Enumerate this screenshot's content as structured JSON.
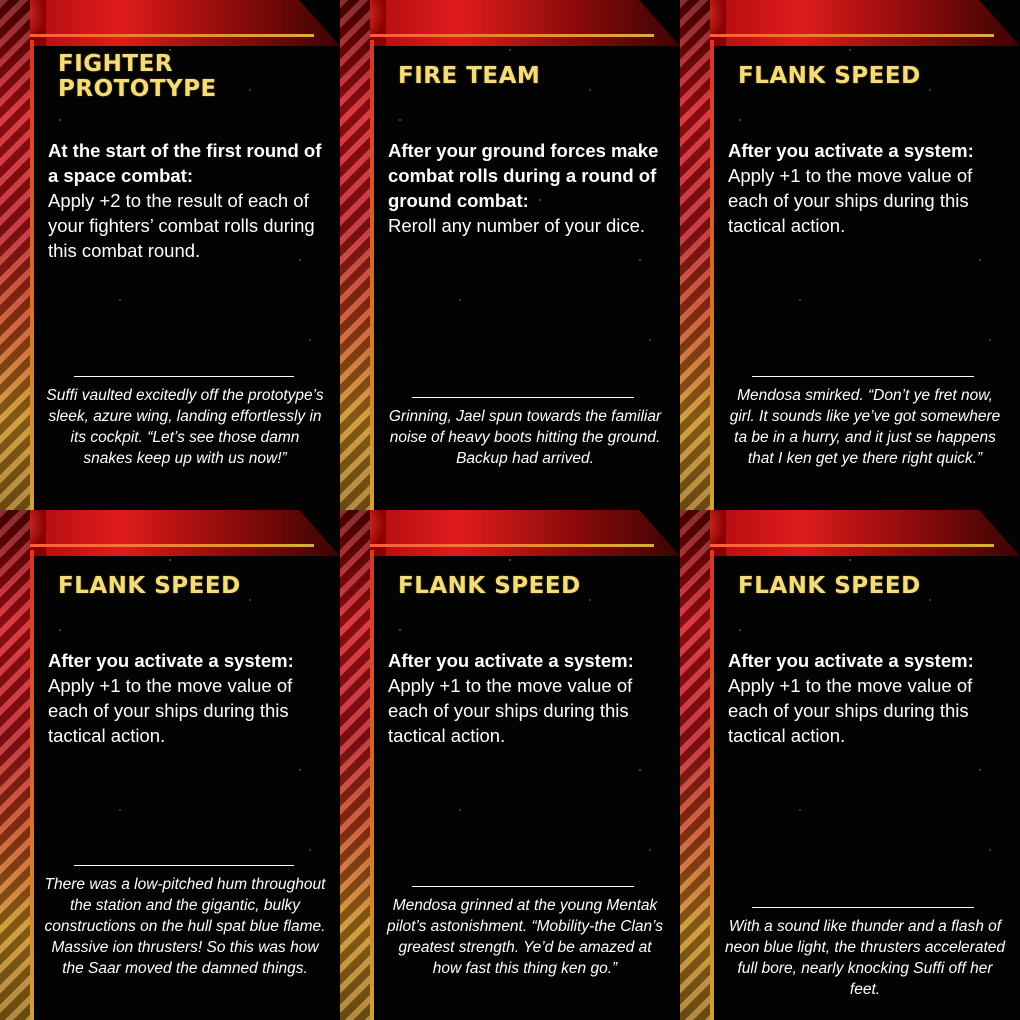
{
  "cards": [
    {
      "title_line1": "FIGHTER",
      "title_line2": "PROTOTYPE",
      "trigger": "At the start of the first round of a space combat:",
      "effect": "Apply +2 to the result of each of your fighters’ combat rolls during this combat round.",
      "flavor": "Suffi vaulted excitedly off the prototype’s sleek, azure wing, landing effortlessly in its cockpit. “Let’s see those damn snakes keep up with us now!”"
    },
    {
      "title_line1": "FIRE TEAM",
      "title_line2": "",
      "trigger": "After your ground forces make combat rolls during a round of ground combat:",
      "effect": "Reroll any number of your dice.",
      "flavor": "Grinning, Jael spun towards the familiar noise of heavy boots hitting the ground. Backup had arrived."
    },
    {
      "title_line1": "FLANK SPEED",
      "title_line2": "",
      "trigger": "After you activate a system:",
      "effect": "Apply +1 to the move value of each of your ships during this tactical action.",
      "flavor": "Mendosa smirked. “Don’t ye fret now, girl. It sounds like ye’ve got somewhere ta be in a hurry, and it just se happens that I ken get ye there right quick.”"
    },
    {
      "title_line1": "FLANK SPEED",
      "title_line2": "",
      "trigger": "After you activate a system:",
      "effect": "Apply +1 to the move value of each of your ships during this tactical action.",
      "flavor": "There was a low-pitched hum throughout the station and the gigantic, bulky constructions on the hull spat blue flame. Massive ion thrusters! So this was how the Saar moved the damned things."
    },
    {
      "title_line1": "FLANK SPEED",
      "title_line2": "",
      "trigger": "After you activate a system:",
      "effect": "Apply +1 to the move value of each of your ships during this tactical action.",
      "flavor": "Mendosa grinned at the young Mentak pilot’s astonishment. “Mobility-the Clan’s greatest strength. Ye’d be amazed at how fast this thing ken go.”"
    },
    {
      "title_line1": "FLANK SPEED",
      "title_line2": "",
      "trigger": "After you activate a system:",
      "effect": "Apply +1 to the move value of each of your ships during this tactical action.",
      "flavor": "With a sound like thunder and a flash of neon blue light, the thrusters accelerated full bore, nearly knocking Suffi off her feet."
    }
  ],
  "colors": {
    "title": "#f3dc7a",
    "frame_red": "#e01c1c",
    "frame_gold": "#d4b040",
    "background": "#030303",
    "text": "#ffffff"
  }
}
